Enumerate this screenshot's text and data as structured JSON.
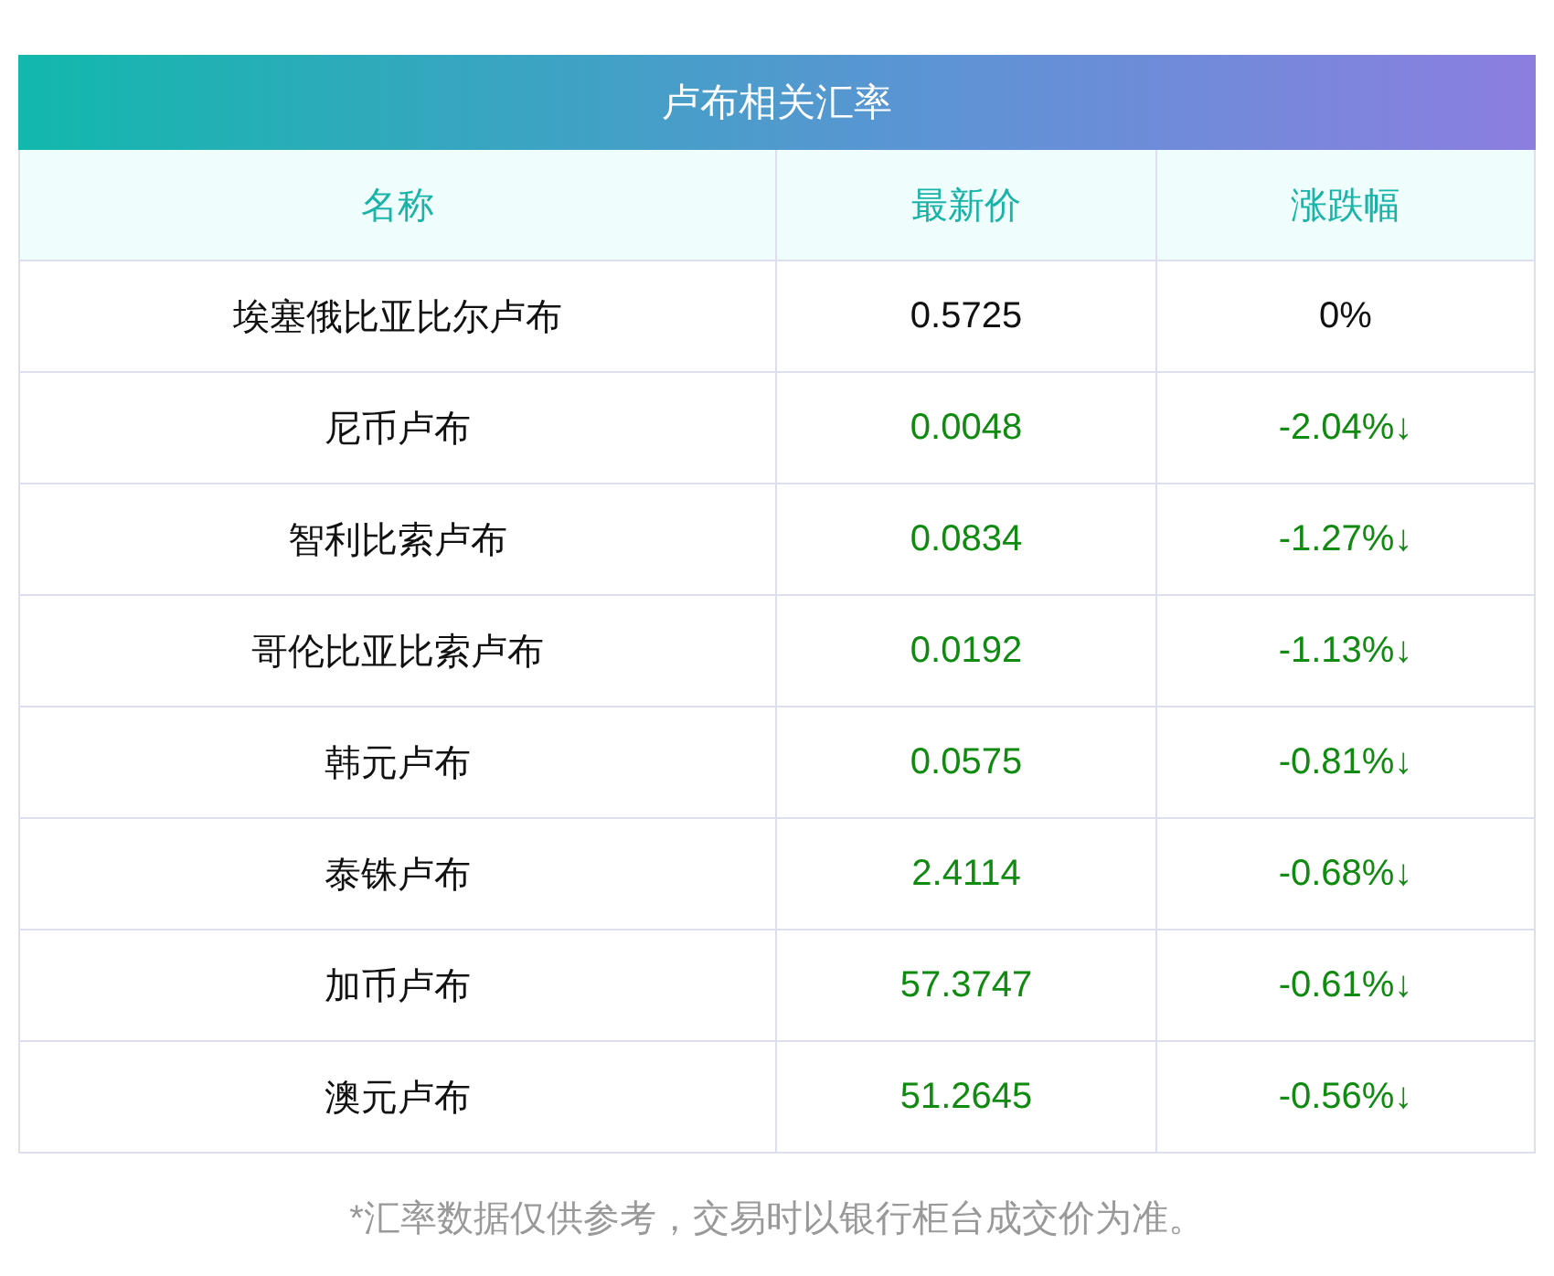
{
  "title": "卢布相关汇率",
  "columns": [
    "名称",
    "最新价",
    "涨跌幅"
  ],
  "rows": [
    {
      "name": "埃塞俄比亚比尔卢布",
      "price": "0.5725",
      "change": "0%",
      "color": "#111111"
    },
    {
      "name": "尼币卢布",
      "price": "0.0048",
      "change": "-2.04%↓",
      "color": "#118a11"
    },
    {
      "name": "智利比索卢布",
      "price": "0.0834",
      "change": "-1.27%↓",
      "color": "#118a11"
    },
    {
      "name": "哥伦比亚比索卢布",
      "price": "0.0192",
      "change": "-1.13%↓",
      "color": "#118a11"
    },
    {
      "name": "韩元卢布",
      "price": "0.0575",
      "change": "-0.81%↓",
      "color": "#118a11"
    },
    {
      "name": "泰铢卢布",
      "price": "2.4114",
      "change": "-0.68%↓",
      "color": "#118a11"
    },
    {
      "name": "加币卢布",
      "price": "57.3747",
      "change": "-0.61%↓",
      "color": "#118a11"
    },
    {
      "name": "澳元卢布",
      "price": "51.2645",
      "change": "-0.56%↓",
      "color": "#118a11"
    }
  ],
  "footnote": "*汇率数据仅供参考，交易时以银行柜台成交价为准。"
}
